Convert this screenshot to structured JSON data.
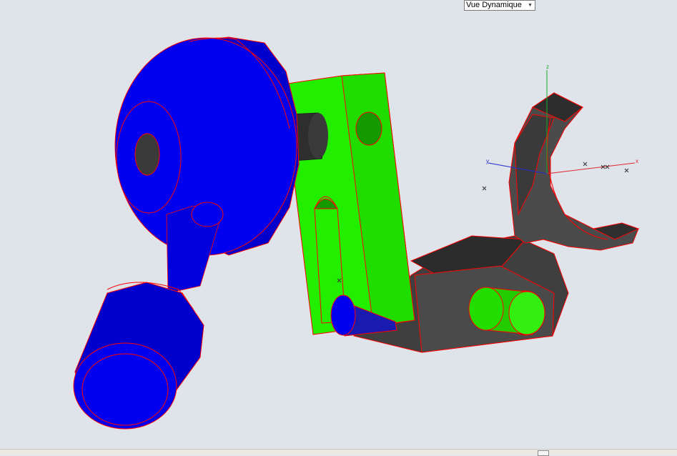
{
  "viewport": {
    "view_mode_selected": "Vue Dynamique",
    "background_color": "#dfe3ea"
  },
  "axes": {
    "x_label": "x",
    "y_label": "y",
    "z_label": "z",
    "x_color": "#e0282f",
    "y_color": "#1e2bd0",
    "z_color": "#1faa2a"
  },
  "model_colors": {
    "blue_part": "#0000ee",
    "green_part": "#22ee00",
    "gray_part": "#4a4a4a",
    "edge": "#ff0000"
  },
  "icons": {
    "dropdown": "chevron-down-icon",
    "status_grip": "grip-icon"
  }
}
